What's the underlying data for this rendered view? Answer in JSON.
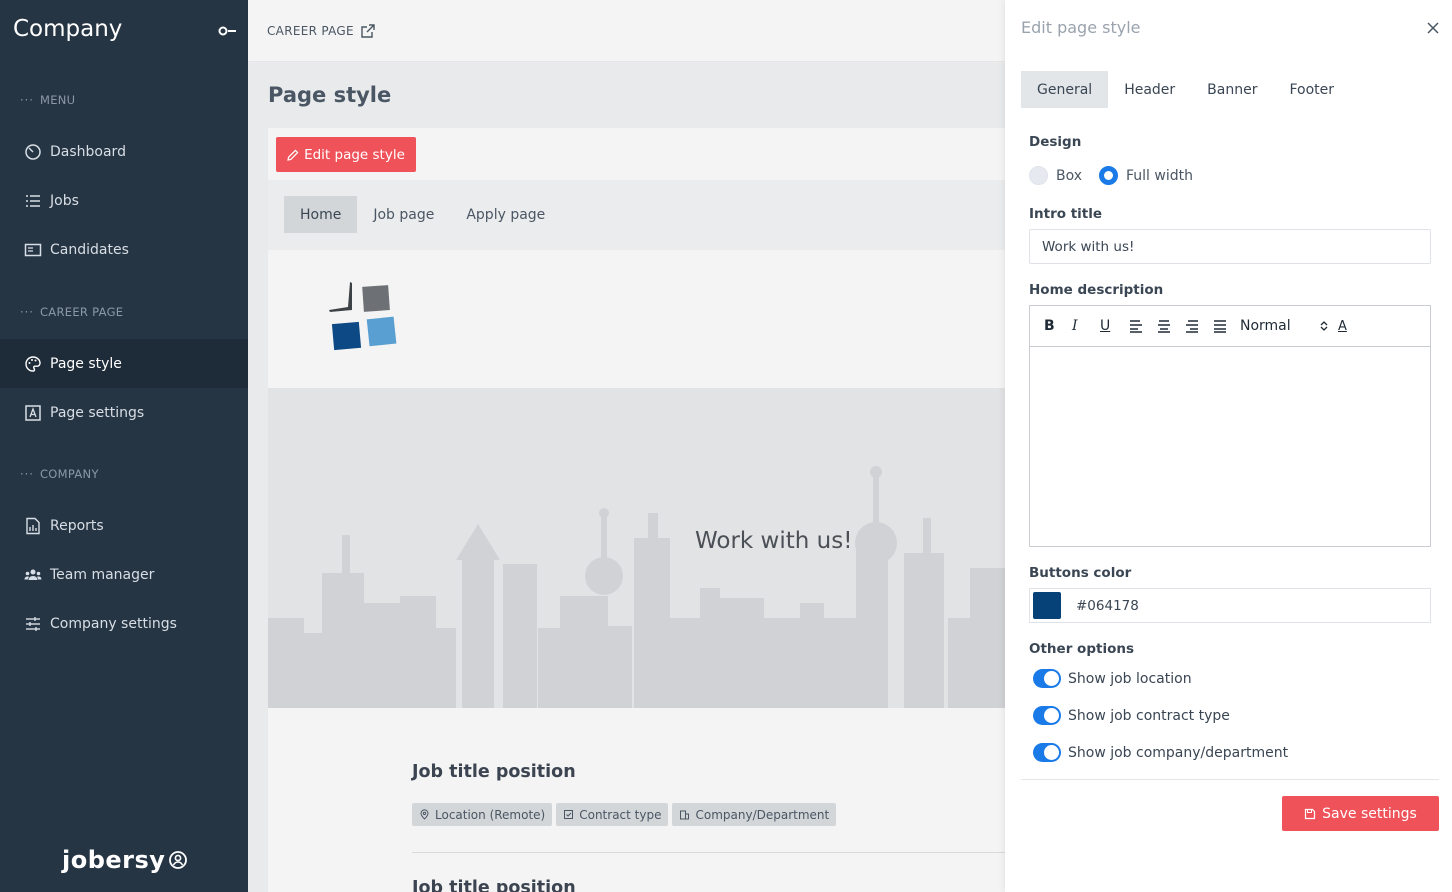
{
  "sidebar": {
    "brand": "Company",
    "sections": {
      "menu": "MENU",
      "career": "CAREER PAGE",
      "company": "COMPANY"
    },
    "items": [
      {
        "label": "Dashboard",
        "icon": "gauge-icon"
      },
      {
        "label": "Jobs",
        "icon": "list-icon"
      },
      {
        "label": "Candidates",
        "icon": "id-card-icon"
      },
      {
        "label": "Page style",
        "icon": "palette-icon",
        "active": true
      },
      {
        "label": "Page settings",
        "icon": "page-settings-icon"
      },
      {
        "label": "Reports",
        "icon": "report-icon"
      },
      {
        "label": "Team manager",
        "icon": "team-icon"
      },
      {
        "label": "Company settings",
        "icon": "sliders-icon"
      }
    ],
    "footer_logo": "jobersy"
  },
  "topbar": {
    "career_link": "CAREER PAGE"
  },
  "main": {
    "page_title": "Page style",
    "edit_button": "Edit page style",
    "preview_tabs": [
      "Home",
      "Job page",
      "Apply page"
    ],
    "banner_title": "Work with us!",
    "jobs": [
      {
        "title": "Job title position",
        "tags": [
          "Location (Remote)",
          "Contract type",
          "Company/Department"
        ]
      },
      {
        "title": "Job title position"
      }
    ]
  },
  "panel": {
    "title": "Edit page style",
    "tabs": [
      "General",
      "Header",
      "Banner",
      "Footer"
    ],
    "design_label": "Design",
    "design_options": [
      "Box",
      "Full width"
    ],
    "intro_title_label": "Intro title",
    "intro_title_value": "Work with us!",
    "home_description_label": "Home description",
    "editor_toolbar": {
      "bold": "B",
      "italic": "I",
      "underline": "U",
      "size": "Normal",
      "color": "A"
    },
    "buttons_color_label": "Buttons color",
    "buttons_color_value": "#064178",
    "other_options_label": "Other options",
    "toggles": [
      "Show job location",
      "Show job contract type",
      "Show job company/department"
    ],
    "save_button": "Save settings"
  },
  "colors": {
    "sidebar_bg": "#263544",
    "accent_red": "#f0525a",
    "toggle_blue": "#1a7be8",
    "swatch": "#064178"
  }
}
